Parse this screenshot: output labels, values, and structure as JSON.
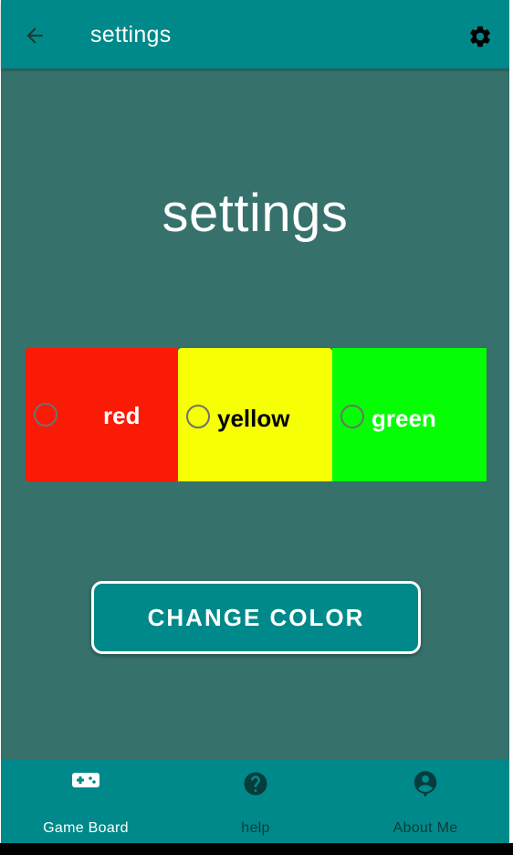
{
  "app_bar": {
    "title": "settings",
    "back_icon": "arrow-left-icon",
    "settings_icon": "gear-icon"
  },
  "page": {
    "heading": "settings"
  },
  "color_options": [
    {
      "label": "red",
      "color": "#fa1a06",
      "selected": false
    },
    {
      "label": "yellow",
      "color": "#f7ff04",
      "selected": false
    },
    {
      "label": "green",
      "color": "#05fe04",
      "selected": false
    }
  ],
  "actions": {
    "change_color_label": "CHANGE COLOR"
  },
  "bottom_nav": {
    "items": [
      {
        "label": "Game Board",
        "icon": "gamepad-icon",
        "active": true
      },
      {
        "label": "help",
        "icon": "help-circle-icon",
        "active": false
      },
      {
        "label": "About Me",
        "icon": "account-circle-icon",
        "active": false
      }
    ]
  },
  "theme": {
    "primary": "#00898a",
    "background": "#36716b",
    "inactive_nav": "#063c3b"
  }
}
